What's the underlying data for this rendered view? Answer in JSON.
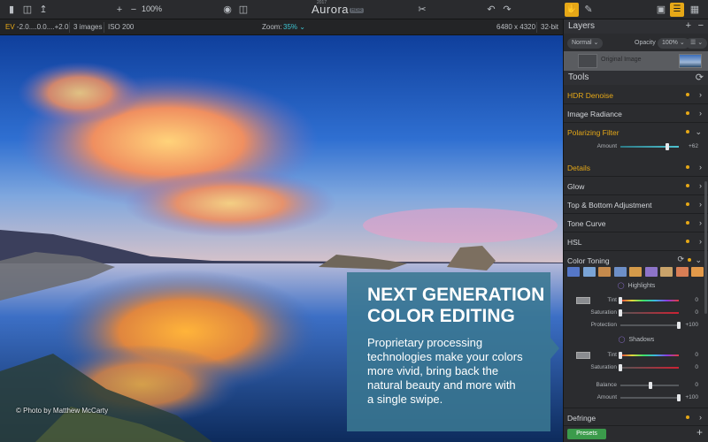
{
  "toolbar": {
    "zoom_percent": "100%",
    "logo_text": "Aurora",
    "logo_badge": "HDR",
    "logo_year": "2017"
  },
  "infobar": {
    "ev_label": "EV",
    "ev_values": "-2.0....0.0....+2.0",
    "images": "3 images",
    "iso": "ISO 200",
    "zoom_label": "Zoom:",
    "zoom_value": "35% ⌄",
    "dimensions": "6480 x 4320",
    "bitdepth": "32-bit"
  },
  "photo": {
    "credit": "© Photo by Matthew McCarty"
  },
  "promo": {
    "headline1": "NEXT GENERATION",
    "headline2": "COLOR EDITING",
    "body": "Proprietary processing\ntechnologies make your colors\nmore vivid, bring back the\nnatural beauty and more with\na single swipe."
  },
  "layers": {
    "title": "Layers",
    "add": "+",
    "remove": "−",
    "blend_mode": "Normal ⌄",
    "opacity_label": "Opacity",
    "opacity_value": "100% ⌄",
    "menu": "☰ ⌄",
    "layer_name": "Original Image"
  },
  "tools": {
    "title": "Tools",
    "refresh": "⟳",
    "items": [
      {
        "label": "HDR Denoise",
        "active": true
      },
      {
        "label": "Image Radiance",
        "active": false
      },
      {
        "label": "Polarizing Filter",
        "active": true
      },
      {
        "label": "Details",
        "active": true
      },
      {
        "label": "Glow",
        "active": false
      },
      {
        "label": "Top & Bottom Adjustment",
        "active": false
      },
      {
        "label": "Tone Curve",
        "active": false
      },
      {
        "label": "HSL",
        "active": false
      },
      {
        "label": "Color Toning",
        "active": false
      },
      {
        "label": "Defringe",
        "active": false
      }
    ],
    "polarizing": {
      "amount_label": "Amount",
      "amount_value": "+62",
      "amount_fraction": 0.81
    },
    "color_toning": {
      "swatch_colors": [
        "#5577c8",
        "#7aa4d6",
        "#c58a4c",
        "#6d8fc7",
        "#d59b4a",
        "#8d74c9",
        "#c9a36a",
        "#d87e55",
        "#e39a4a"
      ],
      "highlights_label": "Highlights",
      "shadows_label": "Shadows",
      "tint_label": "Tint",
      "saturation_label": "Saturation",
      "protection_label": "Protection",
      "balance_label": "Balance",
      "amount_label": "Amount",
      "h_tint_value": "0",
      "h_sat_value": "0",
      "h_prot_value": "+100",
      "s_tint_value": "0",
      "s_sat_value": "0",
      "balance_value": "0",
      "amount_value": "+100"
    }
  },
  "footer": {
    "presets": "Presets",
    "add": "+"
  }
}
